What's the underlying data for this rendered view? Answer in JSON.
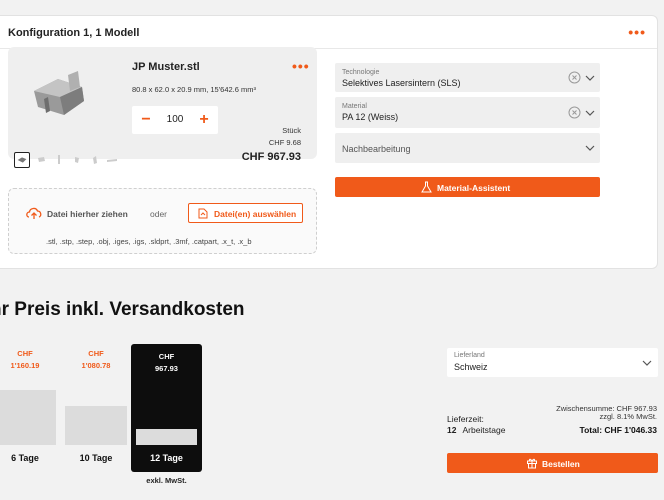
{
  "config": {
    "title": "Konfiguration 1, 1 Modell",
    "menu_dots": "•••"
  },
  "model": {
    "name": "JP Muster.stl",
    "menu_dots": "•••",
    "dimensions": "80.8 x 62.0 x 20.9 mm, 15'642.6 mm³",
    "quantity": "100",
    "minus": "−",
    "plus": "+",
    "unit_label": "Stück",
    "unit_price": "CHF 9.68",
    "total": "CHF 967.93"
  },
  "upload": {
    "drag_text": "Datei hierher ziehen",
    "or_text": "oder",
    "button_label": "Datei(en) auswählen",
    "formats": ".stl, .stp, .step, .obj, .iges, .igs, .sldprt, .3mf, .catpart, .x_t, .x_b"
  },
  "fields": {
    "technology": {
      "label": "Technologie",
      "value": "Selektives Lasersintern (SLS)"
    },
    "material": {
      "label": "Material",
      "value": "PA 12 (Weiss)"
    },
    "finishing": {
      "placeholder": "Nachbearbeitung"
    }
  },
  "assistant_button": "Material-Assistent",
  "price": {
    "title": "hr Preis inkl. Versandkosten",
    "options": [
      {
        "currency": "CHF",
        "amount": "1'160.19",
        "days": "6  Tage",
        "level": 0.62
      },
      {
        "currency": "CHF",
        "amount": "1'080.78",
        "days": "10  Tage",
        "level": 0.45
      },
      {
        "currency": "CHF",
        "amount": "967.93",
        "days": "12  Tage",
        "level": 0.18
      }
    ],
    "excl_vat": "exkl. MwSt."
  },
  "country": {
    "label": "Lieferland",
    "value": "Schweiz"
  },
  "summary": {
    "subtotal": "Zwischensumme: CHF 967.93",
    "vat": "zzgl. 8.1% MwSt.",
    "lead_label": "Lieferzeit:",
    "lead_days": "12",
    "lead_unit": "Arbeitstage",
    "total": "Total: CHF 1'046.33"
  },
  "order_button": "Bestellen",
  "colors": {
    "accent": "#f05a1a",
    "selected": "#0d0d0d"
  }
}
